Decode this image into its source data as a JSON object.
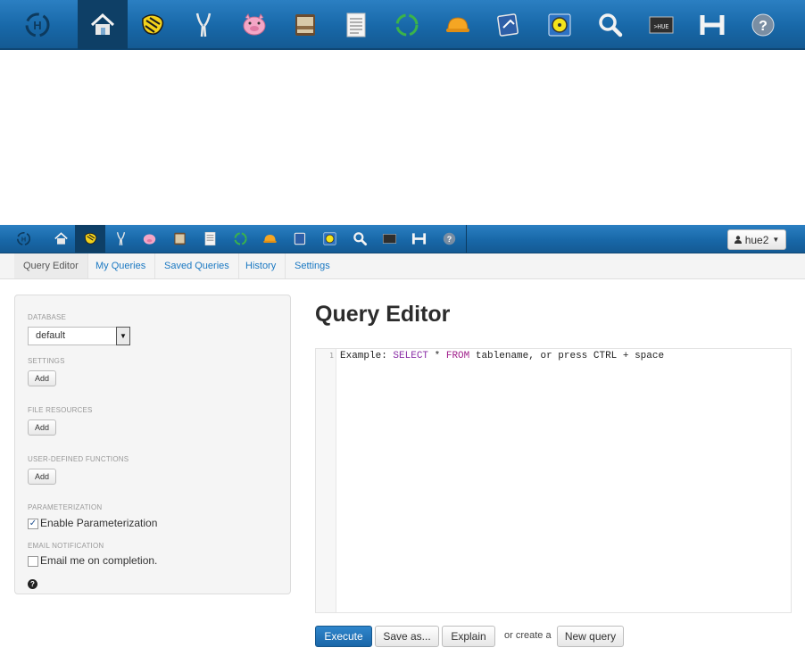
{
  "top_toolbar": {
    "icons": [
      "hue-logo-icon",
      "home-icon",
      "beeswax-hive-icon",
      "impala-icon",
      "pig-icon",
      "file-browser-icon",
      "job-browser-icon",
      "oozie-icon",
      "hbase-hardhat-icon",
      "collection-icon",
      "sqoop-icon",
      "search-icon",
      "shell-icon",
      "hue-h-icon",
      "help-icon"
    ],
    "active": "home-icon"
  },
  "app_bar": {
    "active": "beeswax-hive-icon",
    "user_menu": {
      "label": "hue2",
      "icon": "user-icon"
    }
  },
  "subnav": {
    "tabs": [
      {
        "label": "Query Editor",
        "active": true
      },
      {
        "label": "My Queries",
        "active": false
      },
      {
        "label": "Saved Queries",
        "active": false
      },
      {
        "label": "History",
        "active": false
      },
      {
        "label": "Settings",
        "active": false
      }
    ]
  },
  "sidebar": {
    "database": {
      "label": "DATABASE",
      "value": "default"
    },
    "settings": {
      "label": "SETTINGS",
      "button": "Add"
    },
    "file_resources": {
      "label": "FILE RESOURCES",
      "button": "Add"
    },
    "udf": {
      "label": "USER-DEFINED FUNCTIONS",
      "button": "Add"
    },
    "parameterization": {
      "label": "PARAMETERIZATION",
      "checkbox_label": "Enable Parameterization",
      "checked": true
    },
    "email": {
      "label": "EMAIL NOTIFICATION",
      "checkbox_label": "Email me on completion.",
      "checked": false
    },
    "help_icon": "question-circle-icon"
  },
  "main": {
    "title": "Query Editor",
    "editor": {
      "line_number": "1",
      "placeholder_parts": [
        "Example: ",
        "SELECT",
        " * ",
        "FROM",
        " tablename, or press CTRL + space"
      ]
    },
    "buttons": {
      "execute": "Execute",
      "save_as": "Save as...",
      "explain": "Explain",
      "or_create": "or create a",
      "new_query": "New query"
    }
  },
  "colors": {
    "toolbar_blue": "#1868a8",
    "primary_button": "#2f86cc",
    "link_blue": "#1a78c2"
  }
}
